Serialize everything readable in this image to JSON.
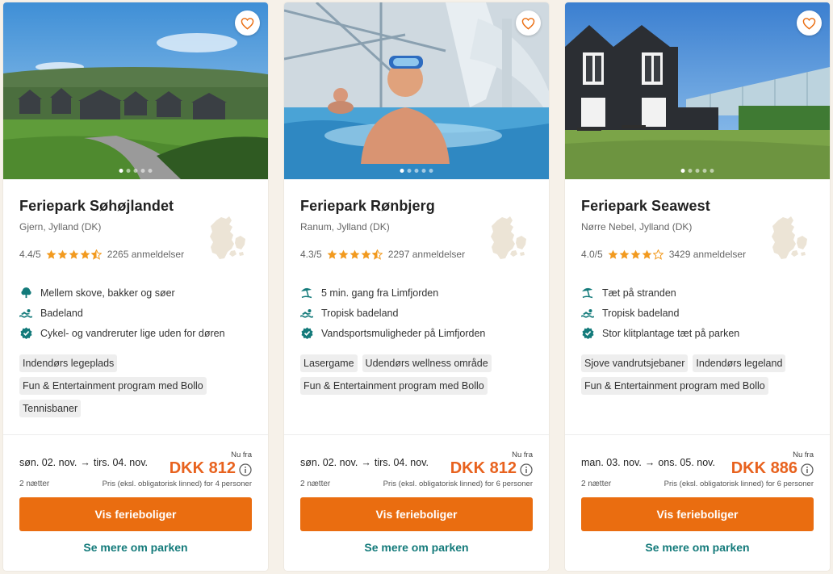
{
  "colors": {
    "accent": "#ea6d10",
    "price": "#e8621e",
    "teal": "#137a7a",
    "star": "#f29a1f"
  },
  "cards": [
    {
      "title": "Feriepark Søhøjlandet",
      "location": "Gjern, Jylland (DK)",
      "rating": "4.4/5",
      "stars": 4.5,
      "reviews": "2265 anmeldelser",
      "features": [
        {
          "icon": "tree-icon",
          "text": "Mellem skove, bakker og søer"
        },
        {
          "icon": "swimmer-icon",
          "text": "Badeland"
        },
        {
          "icon": "check-badge-icon",
          "text": "Cykel- og vandreruter lige uden for døren"
        }
      ],
      "tags": [
        "Indendørs legeplads",
        "Fun & Entertainment program med Bollo",
        "Tennisbaner"
      ],
      "date_from": "søn. 02. nov.",
      "date_to": "tirs. 04. nov.",
      "nights": "2 nætter",
      "nu_fra": "Nu fra",
      "price": "DKK 812",
      "price_note": "Pris (eksl. obligatorisk linned) for 4 personer",
      "cta": "Vis ferieboliger",
      "more": "Se mere om parken",
      "scene": "hills",
      "images": 5,
      "active_image": 0
    },
    {
      "title": "Feriepark Rønbjerg",
      "location": "Ranum, Jylland (DK)",
      "rating": "4.3/5",
      "stars": 4.5,
      "reviews": "2297 anmeldelser",
      "features": [
        {
          "icon": "beach-umbrella-icon",
          "text": "5 min. gang fra Limfjorden"
        },
        {
          "icon": "swimmer-icon",
          "text": "Tropisk badeland"
        },
        {
          "icon": "check-badge-icon",
          "text": "Vandsportsmuligheder på Limfjorden"
        }
      ],
      "tags": [
        "Lasergame",
        "Udendørs wellness område",
        "Fun & Entertainment program med Bollo"
      ],
      "date_from": "søn. 02. nov.",
      "date_to": "tirs. 04. nov.",
      "nights": "2 nætter",
      "nu_fra": "Nu fra",
      "price": "DKK 812",
      "price_note": "Pris (eksl. obligatorisk linned) for 6 personer",
      "cta": "Vis ferieboliger",
      "more": "Se mere om parken",
      "scene": "pool",
      "images": 5,
      "active_image": 0
    },
    {
      "title": "Feriepark Seawest",
      "location": "Nørre Nebel, Jylland (DK)",
      "rating": "4.0/5",
      "stars": 4,
      "reviews": "3429 anmeldelser",
      "features": [
        {
          "icon": "beach-umbrella-icon",
          "text": "Tæt på stranden"
        },
        {
          "icon": "swimmer-icon",
          "text": "Tropisk badeland"
        },
        {
          "icon": "check-badge-icon",
          "text": "Stor klitplantage tæt på parken"
        }
      ],
      "tags": [
        "Sjove vandrutsjebaner",
        "Indendørs legeland",
        "Fun & Entertainment program med Bollo"
      ],
      "date_from": "man. 03. nov.",
      "date_to": "ons. 05. nov.",
      "nights": "2 nætter",
      "nu_fra": "Nu fra",
      "price": "DKK 886",
      "price_note": "Pris (eksl. obligatorisk linned) for 6 personer",
      "cta": "Vis ferieboliger",
      "more": "Se mere om parken",
      "scene": "house",
      "images": 5,
      "active_image": 0
    }
  ]
}
